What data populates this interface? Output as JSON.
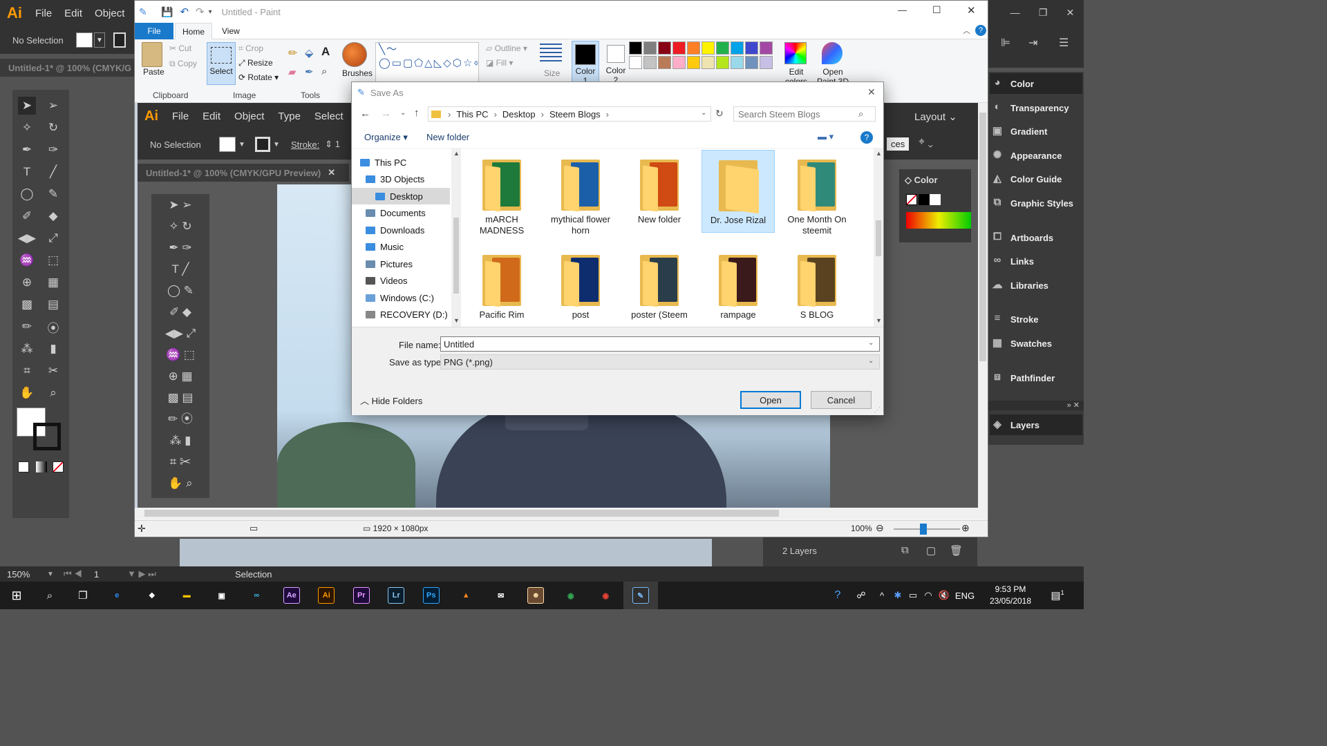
{
  "illustrator": {
    "logo": "Ai",
    "menu": [
      "File",
      "Edit",
      "Object"
    ],
    "selection_label": "No Selection",
    "doc_tab": "Untitled-1* @ 100% (CMYK/G",
    "panels": [
      "Color",
      "Transparency",
      "Gradient",
      "Appearance",
      "Color Guide",
      "Graphic Styles",
      "Artboards",
      "Links",
      "Libraries",
      "Stroke",
      "Swatches",
      "Pathfinder",
      "Layers"
    ],
    "zoom": "150%",
    "artboard_num": "1",
    "status_tool": "Selection",
    "layers_count": "2 Layers"
  },
  "inner_ai": {
    "logo": "Ai",
    "menu": [
      "File",
      "Edit",
      "Object",
      "Type",
      "Select"
    ],
    "selection_label": "No Selection",
    "stroke_label": "Stroke:",
    "stroke_val": "1",
    "doc_tab": "Untitled-1* @ 100% (CMYK/GPU Preview)",
    "layout_label": "Layout",
    "color_tab": "Color",
    "ces_label": "ces"
  },
  "paint": {
    "title": "Untitled - Paint",
    "tabs": {
      "file": "File",
      "home": "Home",
      "view": "View"
    },
    "clipboard": {
      "paste": "Paste",
      "cut": "Cut",
      "copy": "Copy",
      "label": "Clipboard"
    },
    "image": {
      "select": "Select",
      "crop": "Crop",
      "resize": "Resize",
      "rotate": "Rotate",
      "label": "Image"
    },
    "tools_label": "Tools",
    "brushes": "Brushes",
    "outline": "Outline",
    "fill": "Fill",
    "size": "Size",
    "color1": "Color\n1",
    "color2": "Color\n2",
    "edit_colors": "Edit\ncolors",
    "open_3d": "Open\nPaint 3D",
    "palette": [
      "#000000",
      "#7f7f7f",
      "#880015",
      "#ed1c24",
      "#ff7f27",
      "#fff200",
      "#22b14c",
      "#00a2e8",
      "#3f48cc",
      "#a349a4",
      "#ffffff",
      "#c3c3c3",
      "#b97a57",
      "#ffaec9",
      "#ffc90e",
      "#efe4b0",
      "#b5e61d",
      "#99d9ea",
      "#7092be",
      "#c8bfe7"
    ],
    "status": {
      "dimensions": "1920 × 1080px",
      "zoom": "100%"
    }
  },
  "dialog": {
    "title": "Save As",
    "breadcrumb": [
      "This PC",
      "Desktop",
      "Steem Blogs"
    ],
    "search_placeholder": "Search Steem Blogs",
    "organize": "Organize",
    "new_folder": "New folder",
    "help": "?",
    "nav": [
      {
        "label": "This PC",
        "indent": 0,
        "color": "#3b8de0"
      },
      {
        "label": "3D Objects",
        "indent": 1,
        "color": "#3b8de0"
      },
      {
        "label": "Desktop",
        "indent": 1,
        "color": "#3b8de0",
        "selected": true
      },
      {
        "label": "Documents",
        "indent": 1,
        "color": "#6a8caf"
      },
      {
        "label": "Downloads",
        "indent": 1,
        "color": "#3b8de0"
      },
      {
        "label": "Music",
        "indent": 1,
        "color": "#3b8de0"
      },
      {
        "label": "Pictures",
        "indent": 1,
        "color": "#6a8caf"
      },
      {
        "label": "Videos",
        "indent": 1,
        "color": "#555555"
      },
      {
        "label": "Windows (C:)",
        "indent": 1,
        "color": "#6aa0d8"
      },
      {
        "label": "RECOVERY (D:)",
        "indent": 1,
        "color": "#888888"
      }
    ],
    "files": [
      {
        "name": "mARCH\nMADNESS",
        "thumb": "#1e7a3a"
      },
      {
        "name": "mythical flower\nhorn",
        "thumb": "#1b5fa8"
      },
      {
        "name": "New folder",
        "thumb": "#d04a13"
      },
      {
        "name": "Dr. Jose Rizal",
        "thumb": "",
        "selected": true
      },
      {
        "name": "One Month On\nsteemit",
        "thumb": "#2f8a7a"
      },
      {
        "name": "Pacific Rim",
        "thumb": "#d06a1a"
      },
      {
        "name": "post",
        "thumb": "#0d2d6e"
      },
      {
        "name": "poster (Steem",
        "thumb": "#2a3d4a"
      },
      {
        "name": "rampage",
        "thumb": "#3a1a1a"
      },
      {
        "name": "S BLOG",
        "thumb": "#5a4220"
      }
    ],
    "file_name_label": "File name:",
    "file_name": "Untitled",
    "type_label": "Save as type:",
    "type": "PNG (*.png)",
    "hide_folders": "Hide Folders",
    "open_btn": "Open",
    "cancel_btn": "Cancel"
  },
  "taskbar": {
    "apps": [
      {
        "name": "edge",
        "label": "e",
        "bg": "#1c1c1c",
        "fg": "#2b8cf3"
      },
      {
        "name": "dropbox",
        "label": "❖",
        "bg": "#1c1c1c",
        "fg": "#ffffff"
      },
      {
        "name": "explorer",
        "label": "▬",
        "bg": "#1c1c1c",
        "fg": "#f8c400"
      },
      {
        "name": "store",
        "label": "▣",
        "bg": "#1c1c1c",
        "fg": "#ffffff"
      },
      {
        "name": "infinity",
        "label": "∞",
        "bg": "#1c1c1c",
        "fg": "#3db8e8"
      },
      {
        "name": "after-effects",
        "label": "Ae",
        "bg": "#1f0a3c",
        "fg": "#d5a6ff"
      },
      {
        "name": "illustrator",
        "label": "Ai",
        "bg": "#2d1600",
        "fg": "#ff9a00"
      },
      {
        "name": "premiere",
        "label": "Pr",
        "bg": "#1f0a3c",
        "fg": "#e699ff"
      },
      {
        "name": "lightroom",
        "label": "Lr",
        "bg": "#0b1e2d",
        "fg": "#8ec7f0"
      },
      {
        "name": "photoshop",
        "label": "Ps",
        "bg": "#001d33",
        "fg": "#31a8ff"
      },
      {
        "name": "vlc",
        "label": "▲",
        "bg": "#1c1c1c",
        "fg": "#f58220"
      },
      {
        "name": "mail",
        "label": "✉",
        "bg": "#1c1c1c",
        "fg": "#ffffff"
      },
      {
        "name": "photo",
        "label": "☻",
        "bg": "#6a4a30",
        "fg": "#ffddaa"
      },
      {
        "name": "chrome-1",
        "label": "◉",
        "bg": "#1c1c1c",
        "fg": "#34a853"
      },
      {
        "name": "chrome-2",
        "label": "◉",
        "bg": "#1c1c1c",
        "fg": "#ea4335"
      },
      {
        "name": "paint",
        "label": "✎",
        "bg": "#2e2e2e",
        "fg": "#7ab8f5"
      }
    ],
    "lang": "ENG",
    "time": "9:53 PM",
    "date": "23/05/2018",
    "notif": "1"
  }
}
